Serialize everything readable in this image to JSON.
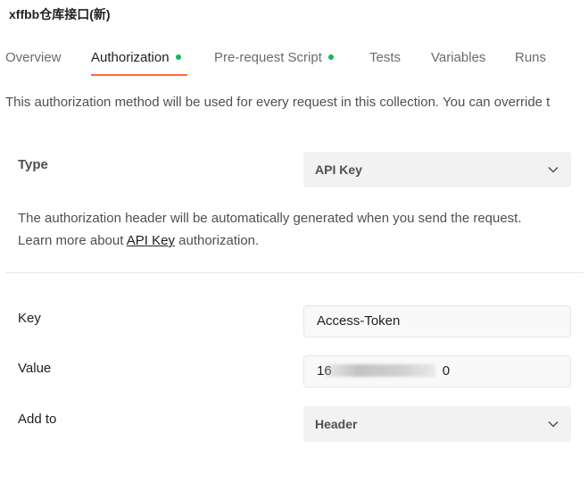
{
  "collection": {
    "title": "xffbb仓库接口(新)"
  },
  "tabs": [
    {
      "label": "Overview",
      "active": false,
      "dot": false
    },
    {
      "label": "Authorization",
      "active": true,
      "dot": true
    },
    {
      "label": "Pre-request Script",
      "active": false,
      "dot": true
    },
    {
      "label": "Tests",
      "active": false,
      "dot": false
    },
    {
      "label": "Variables",
      "active": false,
      "dot": false
    },
    {
      "label": "Runs",
      "active": false,
      "dot": false
    }
  ],
  "description": "This authorization method will be used for every request in this collection. You can override t",
  "auth": {
    "type_label": "Type",
    "type_value": "API Key",
    "info_line1": "The authorization header will be automatically generated when you send the request.",
    "info_line2_prefix": "Learn more about ",
    "info_link": "API Key",
    "info_line2_suffix": " authorization.",
    "key_label": "Key",
    "key_value": "Access-Token",
    "value_label": "Value",
    "value_value_start": "16",
    "value_value_end": "0",
    "add_to_label": "Add to",
    "add_to_value": "Header"
  },
  "colors": {
    "accent": "#ff6c37",
    "status_dot": "#0cbb52"
  },
  "icons": {
    "type_dropdown": "chevron-down-icon",
    "add_to_dropdown": "chevron-down-icon"
  }
}
